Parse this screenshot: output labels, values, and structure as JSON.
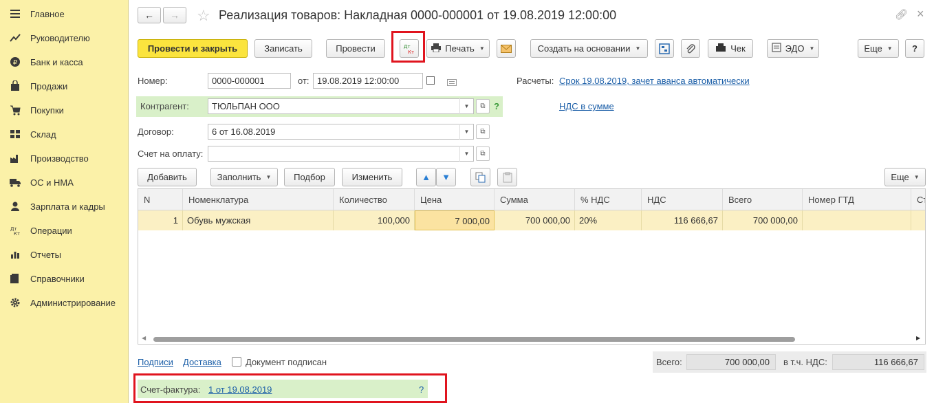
{
  "sidebar": {
    "items": [
      {
        "label": "Главное",
        "icon": "menu-icon"
      },
      {
        "label": "Руководителю",
        "icon": "trend-icon"
      },
      {
        "label": "Банк и касса",
        "icon": "ruble-icon"
      },
      {
        "label": "Продажи",
        "icon": "bag-icon"
      },
      {
        "label": "Покупки",
        "icon": "cart-icon"
      },
      {
        "label": "Склад",
        "icon": "warehouse-icon"
      },
      {
        "label": "Производство",
        "icon": "factory-icon"
      },
      {
        "label": "ОС и НМА",
        "icon": "truck-icon"
      },
      {
        "label": "Зарплата и кадры",
        "icon": "person-icon"
      },
      {
        "label": "Операции",
        "icon": "dt-kt-icon"
      },
      {
        "label": "Отчеты",
        "icon": "bar-chart-icon"
      },
      {
        "label": "Справочники",
        "icon": "book-icon"
      },
      {
        "label": "Администрирование",
        "icon": "gear-icon"
      }
    ]
  },
  "header": {
    "title": "Реализация товаров: Накладная 0000-000001 от 19.08.2019 12:00:00"
  },
  "toolbar": {
    "post_close": "Провести и закрыть",
    "save": "Записать",
    "post": "Провести",
    "dtkt_top": "Дт",
    "dtkt_bottom": "Кт",
    "print": "Печать",
    "create_based": "Создать на основании",
    "receipt": "Чек",
    "edo": "ЭДО",
    "more": "Еще",
    "help": "?"
  },
  "form": {
    "number_label": "Номер:",
    "number_value": "0000-000001",
    "date_label": "от:",
    "date_value": "19.08.2019 12:00:00",
    "settlements_label": "Расчеты:",
    "settlements_link": "Срок 19.08.2019, зачет аванса автоматически",
    "vat_link": "НДС в сумме",
    "counterparty_label": "Контрагент:",
    "counterparty_value": "ТЮЛЬПАН ООО",
    "counterparty_help": "?",
    "contract_label": "Договор:",
    "contract_value": "6 от 16.08.2019",
    "invoice_label": "Счет на оплату:",
    "invoice_value": ""
  },
  "table_toolbar": {
    "add": "Добавить",
    "fill": "Заполнить",
    "pick": "Подбор",
    "change": "Изменить",
    "more": "Еще"
  },
  "table": {
    "columns": [
      "N",
      "Номенклатура",
      "Количество",
      "Цена",
      "Сумма",
      "% НДС",
      "НДС",
      "Всего",
      "Номер ГТД",
      "Ст"
    ],
    "rows": [
      [
        "1",
        "Обувь мужская",
        "100,000",
        "7 000,00",
        "700 000,00",
        "20%",
        "116 666,67",
        "700 000,00",
        "",
        ""
      ]
    ]
  },
  "footer": {
    "signatures": "Подписи",
    "delivery": "Доставка",
    "signed_label": "Документ подписан",
    "total_label": "Всего:",
    "total_value": "700 000,00",
    "vat_label": "в т.ч. НДС:",
    "vat_value": "116 666,67",
    "invoice_label": "Счет-фактура:",
    "invoice_link": "1 от 19.08.2019",
    "invoice_help": "?"
  },
  "colors": {
    "sidebar_bg": "#fbf1a8",
    "primary_button": "#fbe43e",
    "highlight_red": "#e0141e",
    "green_band": "#d9f0c9",
    "link": "#1c5fa8"
  }
}
